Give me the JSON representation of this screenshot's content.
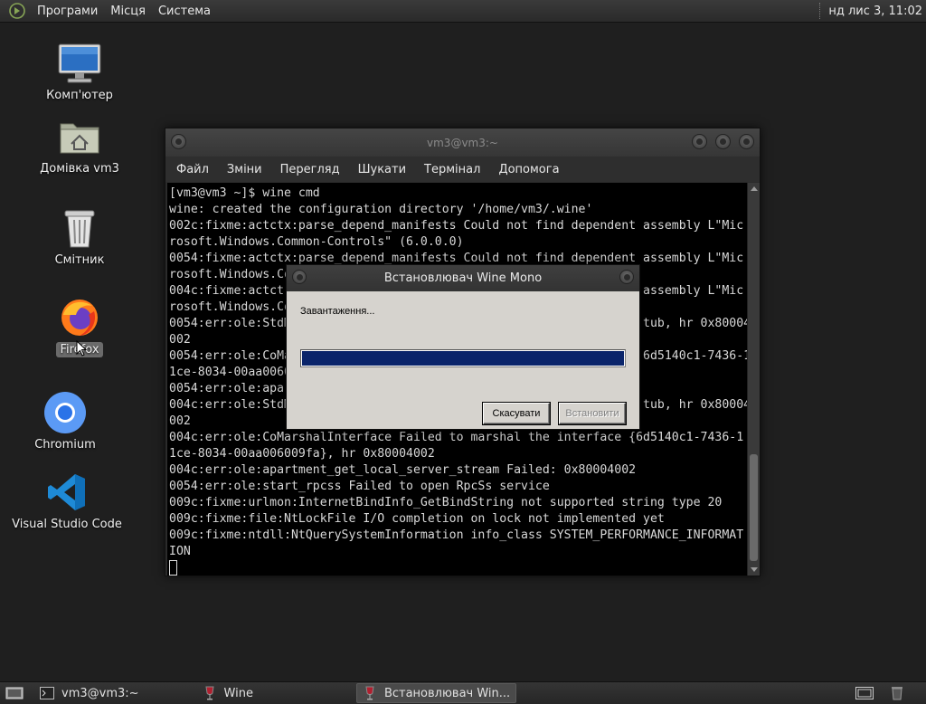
{
  "top_panel": {
    "menus": [
      "Програми",
      "Місця",
      "Система"
    ],
    "clock": "нд лис  3, 11:02"
  },
  "desktop": {
    "icons": [
      {
        "label": "Комп'ютер",
        "icon": "computer-icon"
      },
      {
        "label": "Домівка vm3",
        "icon": "home-folder-icon"
      },
      {
        "label": "Смітник",
        "icon": "trash-icon"
      },
      {
        "label": "Firefox",
        "icon": "firefox-icon"
      },
      {
        "label": "Chromium",
        "icon": "chromium-icon"
      },
      {
        "label": "Visual Studio Code",
        "icon": "vscode-icon"
      }
    ]
  },
  "terminal": {
    "title": "vm3@vm3:~",
    "menu": [
      "Файл",
      "Зміни",
      "Перегляд",
      "Шукати",
      "Термінал",
      "Допомога"
    ],
    "lines": [
      "[vm3@vm3 ~]$ wine cmd",
      "wine: created the configuration directory '/home/vm3/.wine'",
      "002c:fixme:actctx:parse_depend_manifests Could not find dependent assembly L\"Mic",
      "rosoft.Windows.Common-Controls\" (6.0.0.0)",
      "0054:fixme:actctx:parse_depend_manifests Could not find dependent assembly L\"Mic",
      "rosoft.Windows.Co",
      "004c:fixme:actct                                                  assembly L\"Mic",
      "rosoft.Windows.Co",
      "0054:err:ole:StdM                                                 tub, hr 0x80004",
      "002",
      "0054:err:ole:CoMa                                                 6d5140c1-7436-1",
      "1ce-8034-00aa0060",
      "0054:err:ole:apar",
      "004c:err:ole:StdM                                                 tub, hr 0x80004",
      "002",
      "004c:err:ole:CoMarshalInterface Failed to marshal the interface {6d5140c1-7436-1",
      "1ce-8034-00aa006009fa}, hr 0x80004002",
      "004c:err:ole:apartment_get_local_server_stream Failed: 0x80004002",
      "0054:err:ole:start_rpcss Failed to open RpcSs service",
      "009c:fixme:urlmon:InternetBindInfo_GetBindString not supported string type 20",
      "009c:fixme:file:NtLockFile I/O completion on lock not implemented yet",
      "009c:fixme:ntdll:NtQuerySystemInformation info_class SYSTEM_PERFORMANCE_INFORMAT",
      "ION"
    ]
  },
  "dialog": {
    "title": "Встановлювач Wine Mono",
    "status": "Завантаження...",
    "progress": 1.0,
    "cancel_label": "Скасувати",
    "install_label": "Встановити"
  },
  "taskbar": {
    "tasks": [
      {
        "label": "vm3@vm3:~",
        "icon": "terminal-icon",
        "active": false
      },
      {
        "label": "Wine",
        "icon": "wine-icon",
        "active": false
      },
      {
        "label": "Встановлювач Win...",
        "icon": "wine-icon",
        "active": true
      }
    ]
  },
  "colors": {
    "progress_fill": "#0a246a",
    "terminal_bg": "#000000",
    "dialog_bg": "#d6d3ce"
  }
}
